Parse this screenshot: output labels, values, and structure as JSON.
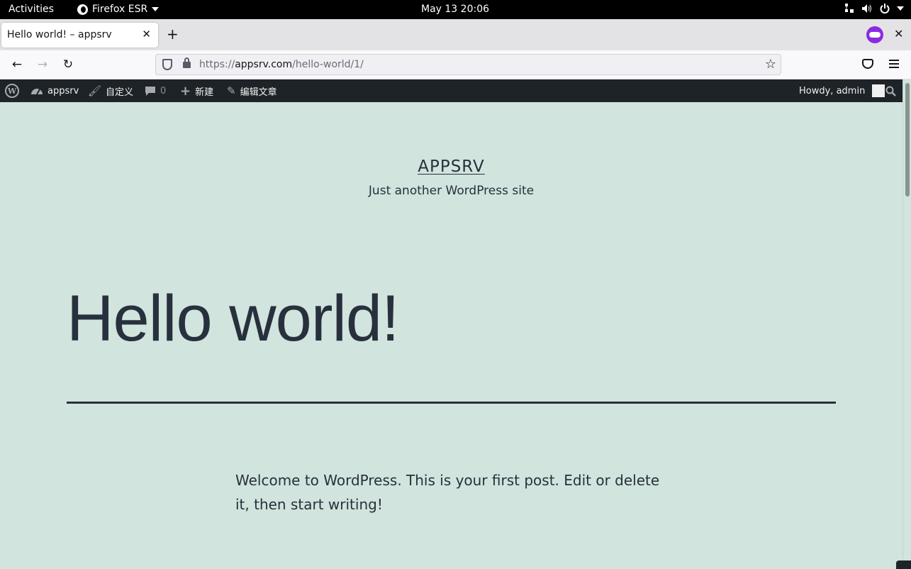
{
  "system_bar": {
    "activities": "Activities",
    "app_name": "Firefox ESR",
    "clock": "May 13  20:06"
  },
  "browser": {
    "tab_title": "Hello world! – appsrv",
    "url_prefix": "https://",
    "url_host": "appsrv.com",
    "url_path": "/hello-world/1/"
  },
  "wp_admin_bar": {
    "site_name": "appsrv",
    "customize": "自定义",
    "comments_count": "0",
    "new": "新建",
    "edit_post": "编辑文章",
    "howdy": "Howdy, admin"
  },
  "site": {
    "title": "APPSRV",
    "description": "Just another WordPress site"
  },
  "post": {
    "title": "Hello world!",
    "body": "Welcome to WordPress. This is your first post. Edit or delete it, then start writing!"
  },
  "colors": {
    "page_background": "#d1e4dd",
    "text": "#28303d",
    "admin_bar": "#1d2327"
  }
}
